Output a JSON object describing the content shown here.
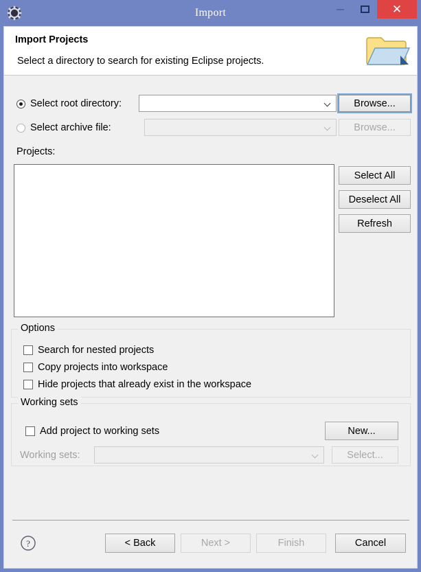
{
  "window": {
    "title": "Import",
    "app_icon": "gear-icon",
    "controls": {
      "minimize": "minimize-icon",
      "maximize": "maximize-icon",
      "close": "✕"
    },
    "frame_color": "#7184c4",
    "close_button_color": "#e04343"
  },
  "banner": {
    "title": "Import Projects",
    "description": "Select a directory to search for existing Eclipse projects.",
    "icon": "import-folder-icon"
  },
  "source": {
    "root_directory": {
      "label": "Select root directory:",
      "selected": true,
      "combo_value": "",
      "browse_label": "Browse..."
    },
    "archive_file": {
      "label": "Select archive file:",
      "selected": false,
      "combo_value": "",
      "browse_label": "Browse..."
    }
  },
  "projects": {
    "label": "Projects:",
    "items": [],
    "buttons": {
      "select_all": "Select All",
      "deselect_all": "Deselect All",
      "refresh": "Refresh"
    }
  },
  "options": {
    "title": "Options",
    "items": [
      {
        "label": "Search for nested projects",
        "checked": false
      },
      {
        "label": "Copy projects into workspace",
        "checked": false
      },
      {
        "label": "Hide projects that already exist in the workspace",
        "checked": false
      }
    ]
  },
  "working_sets": {
    "title": "Working sets",
    "add_checkbox": {
      "label": "Add project to working sets",
      "checked": false
    },
    "new_label": "New...",
    "sets_label": "Working sets:",
    "sets_value": "",
    "select_label": "Select..."
  },
  "footer": {
    "help": "?",
    "back": "< Back",
    "next": "Next >",
    "finish": "Finish",
    "cancel": "Cancel"
  }
}
